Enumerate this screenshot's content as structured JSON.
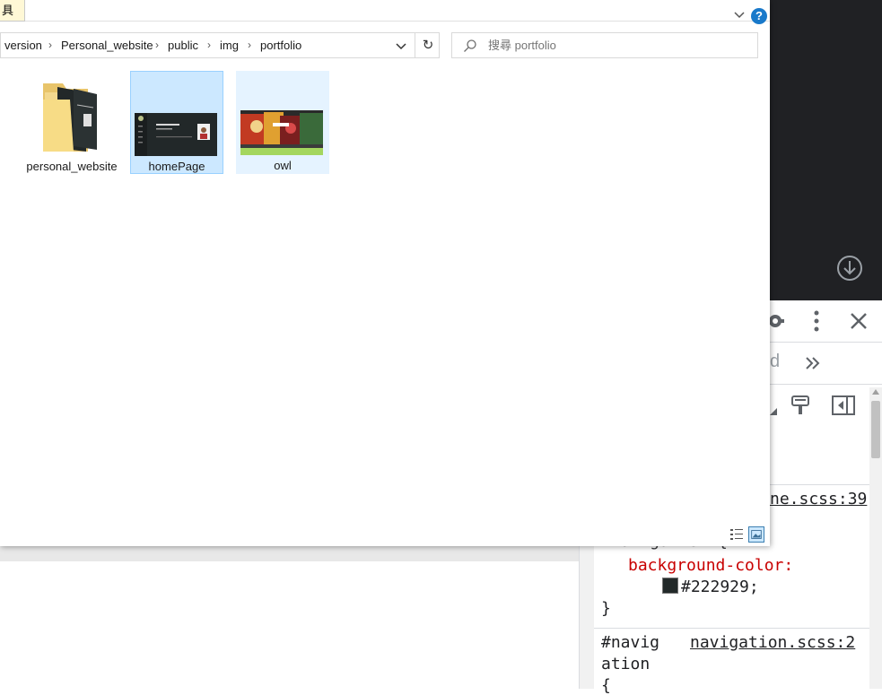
{
  "explorer": {
    "ribbon_tab_label": "具",
    "breadcrumbs": [
      "version",
      "Personal_website",
      "public",
      "img",
      "portfolio"
    ],
    "search_placeholder": "搜尋 portfolio",
    "items": [
      {
        "name": "personal_website",
        "type": "folder"
      },
      {
        "name": "homePage",
        "type": "image",
        "state": "selected"
      },
      {
        "name": "owl",
        "type": "image",
        "state": "hover"
      }
    ],
    "help_label": "?",
    "refresh_glyph": "↻"
  },
  "devtools": {
    "tabs_overflow_fragment": "d",
    "rules": [
      {
        "source": "ne.scss:39",
        "selector": "#navigation {",
        "property": "background-color:",
        "value": "#222929;",
        "close": "}"
      },
      {
        "selector_line1": "#navig",
        "selector_line2": "ation",
        "source": "navigation.scss:2",
        "open": "{"
      }
    ]
  },
  "colors": {
    "selection_bg": "#cce8ff",
    "hover_bg": "#e5f3ff",
    "dark_page": "#202124",
    "swatch": "#222929",
    "help_blue": "#1979ca"
  }
}
